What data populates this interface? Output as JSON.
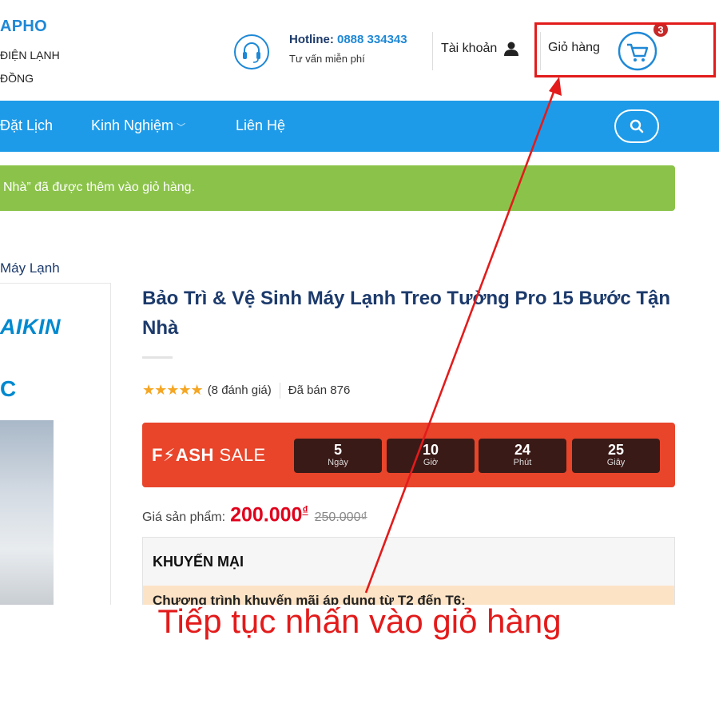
{
  "header": {
    "brand_name": "APHO",
    "brand_line1": "ĐIỆN LẠNH",
    "brand_line2": "ĐỒNG",
    "hotline_label": "Hotline:",
    "hotline_number": "0888 334343",
    "hotline_sub": "Tư vấn miễn phí",
    "account_label": "Tài khoản",
    "cart_label": "Giỏ hàng",
    "cart_count": "3"
  },
  "nav": {
    "items": [
      {
        "label": "Đặt Lịch"
      },
      {
        "label": "Kinh Nghiệm"
      },
      {
        "label": "Liên Hệ"
      }
    ]
  },
  "notice": {
    "text": "Nhà” đã được thêm vào giỏ hàng."
  },
  "breadcrumb": {
    "text": "Máy Lạnh"
  },
  "gallery": {
    "logo_text": "AIKIN",
    "fragment_text": "C"
  },
  "product": {
    "title": "Bảo Trì & Vệ Sinh Máy Lạnh Treo Tường Pro 15 Bước Tận Nhà",
    "rating_stars": 5,
    "rating_text": "(8 đánh giá)",
    "sold_text": "Đã bán 876",
    "flash_sale": {
      "title_bold": "F⚡ASH",
      "title_light": "SALE",
      "countdown": [
        {
          "num": "5",
          "unit": "Ngày"
        },
        {
          "num": "10",
          "unit": "Giờ"
        },
        {
          "num": "24",
          "unit": "Phút"
        },
        {
          "num": "25",
          "unit": "Giây"
        }
      ]
    },
    "price_label": "Giá sản phẩm:",
    "price_now": "200.000",
    "currency": "₫",
    "price_old": "250.000₫",
    "promo_title": "KHUYẾN MẠI",
    "promo_line": "Chương trình khuyến mãi áp dụng từ T2 đến T6:"
  },
  "annotation": {
    "caption": "Tiếp tục nhấn vào giỏ hàng",
    "color": "#e31b1b"
  },
  "colors": {
    "primary_blue": "#1e9be8",
    "navy": "#1c3a6b",
    "success_green": "#8bc34a",
    "flash_red": "#e8452b",
    "price_red": "#e0001b"
  }
}
